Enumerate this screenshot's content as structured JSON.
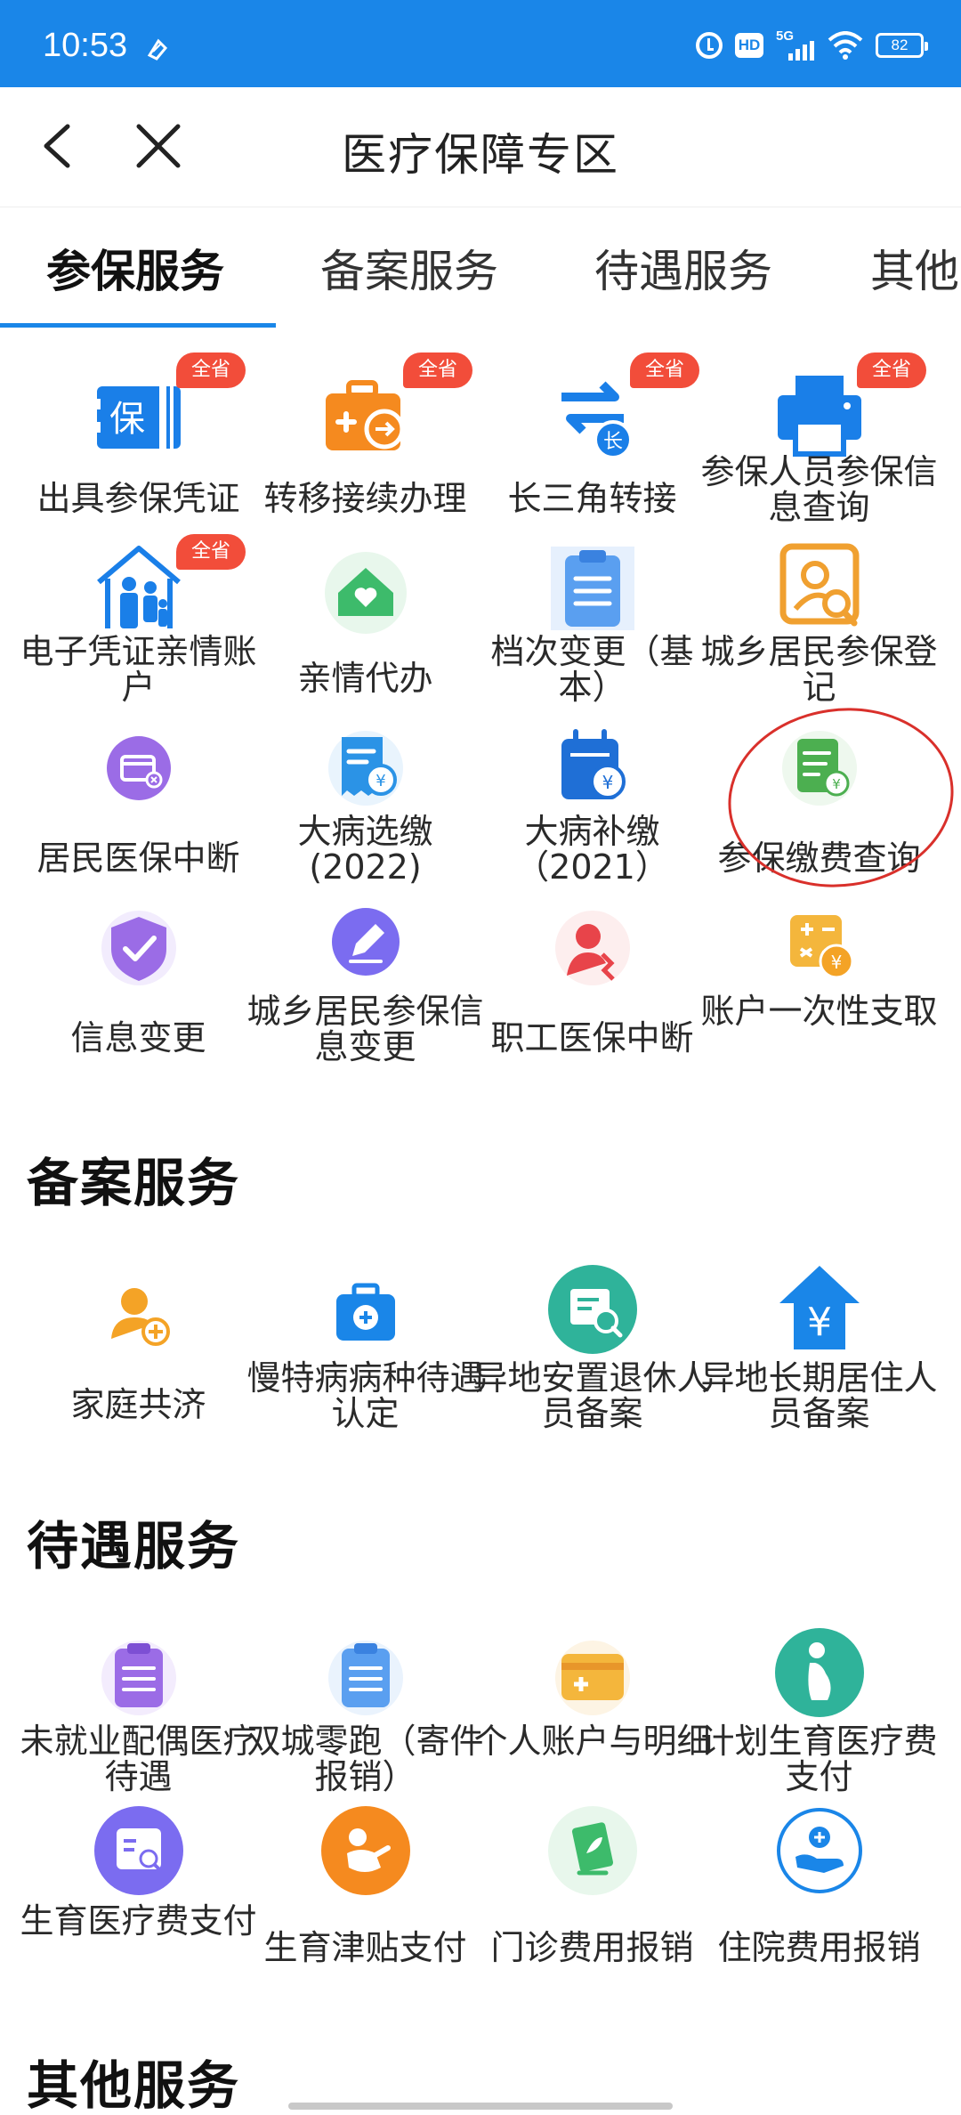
{
  "status_bar": {
    "time": "10:53",
    "network": "5G",
    "hd": "HD",
    "battery": "82",
    "icons": [
      "alarm-icon",
      "hd-icon",
      "5g-signal-icon",
      "wifi-icon",
      "battery-icon"
    ]
  },
  "header": {
    "title": "医疗保障专区",
    "back_icon": "chevron-left-icon",
    "close_icon": "close-icon"
  },
  "tabs": [
    {
      "label": "参保服务",
      "active": true
    },
    {
      "label": "备案服务",
      "active": false
    },
    {
      "label": "待遇服务",
      "active": false
    },
    {
      "label": "其他",
      "active": false
    }
  ],
  "colors": {
    "brand": "#1a86e8",
    "badge": "#f24d3a",
    "annotation": "#d9302b"
  },
  "badge_text": "全省",
  "insurance_services": {
    "items": [
      {
        "label": "出具参保凭证",
        "icon": "insurance-certificate-icon",
        "badge": true
      },
      {
        "label": "转移接续办理",
        "icon": "briefcase-transfer-icon",
        "badge": true
      },
      {
        "label": "长三角转接",
        "icon": "swap-arrows-icon",
        "badge": true,
        "icon_text": "长"
      },
      {
        "label": "参保人员参保信息查询",
        "icon": "printer-icon",
        "badge": true
      },
      {
        "label": "电子凭证亲情账户",
        "icon": "family-house-icon",
        "badge": true
      },
      {
        "label": "亲情代办",
        "icon": "heart-house-icon",
        "badge": false
      },
      {
        "label": "档次变更（基本）",
        "icon": "clipboard-list-icon",
        "badge": false
      },
      {
        "label": "城乡居民参保登记",
        "icon": "user-search-icon",
        "badge": false
      },
      {
        "label": "居民医保中断",
        "icon": "card-cancel-icon",
        "badge": false
      },
      {
        "label": "大病选缴(2022)",
        "icon": "bill-yen-icon",
        "badge": false
      },
      {
        "label": "大病补缴（2021）",
        "icon": "calendar-yen-icon",
        "badge": false
      },
      {
        "label": "参保缴费查询",
        "icon": "document-yen-icon",
        "badge": false
      },
      {
        "label": "信息变更",
        "icon": "shield-check-icon",
        "badge": false
      },
      {
        "label": "城乡居民参保信息变更",
        "icon": "pencil-edit-icon",
        "badge": false
      },
      {
        "label": "职工医保中断",
        "icon": "user-break-icon",
        "badge": false
      },
      {
        "label": "账户一次性支取",
        "icon": "calculator-yen-icon",
        "badge": false
      }
    ]
  },
  "filing_services": {
    "title": "备案服务",
    "items": [
      {
        "label": "家庭共济",
        "icon": "user-add-icon"
      },
      {
        "label": "慢特病病种待遇认定",
        "icon": "medical-kit-icon"
      },
      {
        "label": "异地安置退休人员备案",
        "icon": "document-search-icon"
      },
      {
        "label": "异地长期居住人员备案",
        "icon": "house-yen-icon"
      }
    ]
  },
  "benefit_services": {
    "title": "待遇服务",
    "items": [
      {
        "label": "未就业配偶医疗待遇",
        "icon": "clipboard-purple-icon"
      },
      {
        "label": "双城零跑（寄件报销）",
        "icon": "clipboard-blue-icon"
      },
      {
        "label": "个人账户与明细",
        "icon": "medical-card-icon"
      },
      {
        "label": "计划生育医疗费支付",
        "icon": "pregnancy-icon"
      },
      {
        "label": "生育医疗费支付",
        "icon": "stroller-search-icon"
      },
      {
        "label": "生育津贴支付",
        "icon": "baby-icon"
      },
      {
        "label": "门诊费用报销",
        "icon": "herb-card-icon"
      },
      {
        "label": "住院费用报销",
        "icon": "hand-cross-icon"
      }
    ]
  },
  "other_services": {
    "title": "其他服务"
  }
}
